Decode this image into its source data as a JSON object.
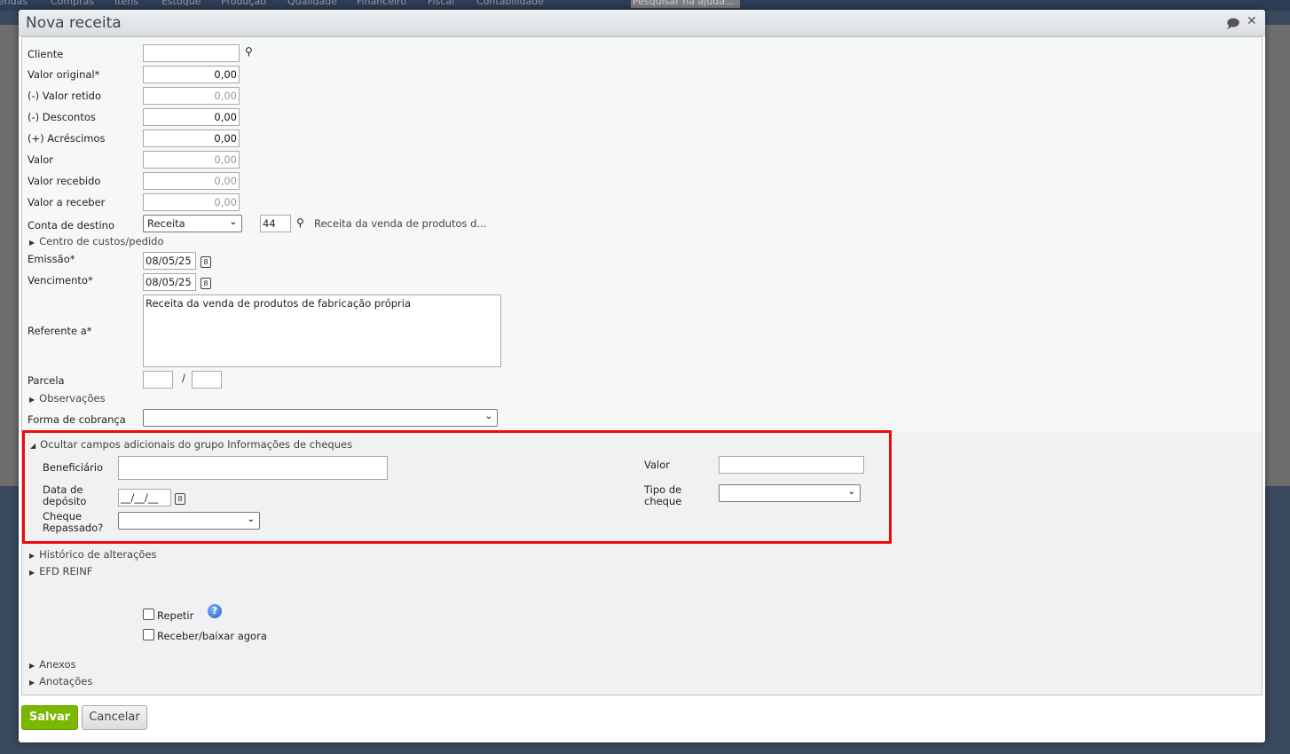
{
  "background": {
    "nav": [
      "endas",
      "Compras",
      "Itens",
      "Estoque",
      "Produção",
      "Qualidade",
      "Financeiro",
      "Fiscal",
      "Contabilidade"
    ],
    "search_placeholder": "Pesquisar na ajuda..."
  },
  "dialog": {
    "title": "Nova receita",
    "fields": {
      "cliente": {
        "label": "Cliente",
        "value": ""
      },
      "valor_original": {
        "label": "Valor original*",
        "value": "0,00"
      },
      "valor_retido": {
        "label": "(-) Valor retido",
        "value": "0,00"
      },
      "descontos": {
        "label": "(-) Descontos",
        "value": "0,00"
      },
      "acrescimos": {
        "label": "(+) Acréscimos",
        "value": "0,00"
      },
      "valor": {
        "label": "Valor",
        "value": "0,00"
      },
      "valor_recebido": {
        "label": "Valor recebido",
        "value": "0,00"
      },
      "valor_a_receber": {
        "label": "Valor a receber",
        "value": "0,00"
      },
      "conta_destino": {
        "label": "Conta de destino",
        "selected": "Receita",
        "code": "44",
        "description": "Receita da venda de produtos d..."
      },
      "centro_custos": "Centro de custos/pedido",
      "emissao": {
        "label": "Emissão*",
        "value": "08/05/25"
      },
      "vencimento": {
        "label": "Vencimento*",
        "value": "08/05/25"
      },
      "referente": {
        "label": "Referente a*",
        "value": "Receita da venda de produtos de fabricação própria"
      },
      "parcela": {
        "label": "Parcela",
        "value1": "",
        "separator": "/",
        "value2": ""
      },
      "observacoes": "Observações",
      "forma_cobranca": {
        "label": "Forma de cobrança",
        "selected": ""
      }
    },
    "cheques": {
      "toggle": "Ocultar campos adicionais do grupo Informações de cheques",
      "beneficiario": "Beneficiário",
      "data_deposito": {
        "label1": "Data de",
        "label2": "depósito",
        "value": "__/__/__"
      },
      "cheque_repassado": {
        "label1": "Cheque",
        "label2": "Repassado?",
        "selected": ""
      },
      "valor": {
        "label": "Valor",
        "value": ""
      },
      "tipo_cheque": {
        "label1": "Tipo de",
        "label2": "cheque",
        "selected": ""
      }
    },
    "sections": {
      "historico": "Histórico de alterações",
      "efd": "EFD REINF",
      "anexos": "Anexos",
      "anotacoes": "Anotações"
    },
    "checkboxes": {
      "repetir": {
        "label": "Repetir",
        "checked": false
      },
      "receber": {
        "label": "Receber/baixar agora",
        "checked": false
      }
    },
    "buttons": {
      "save": "Salvar",
      "cancel": "Cancelar"
    },
    "colors": {
      "save": "#7ab800",
      "highlight": "#ee0a0a"
    }
  }
}
